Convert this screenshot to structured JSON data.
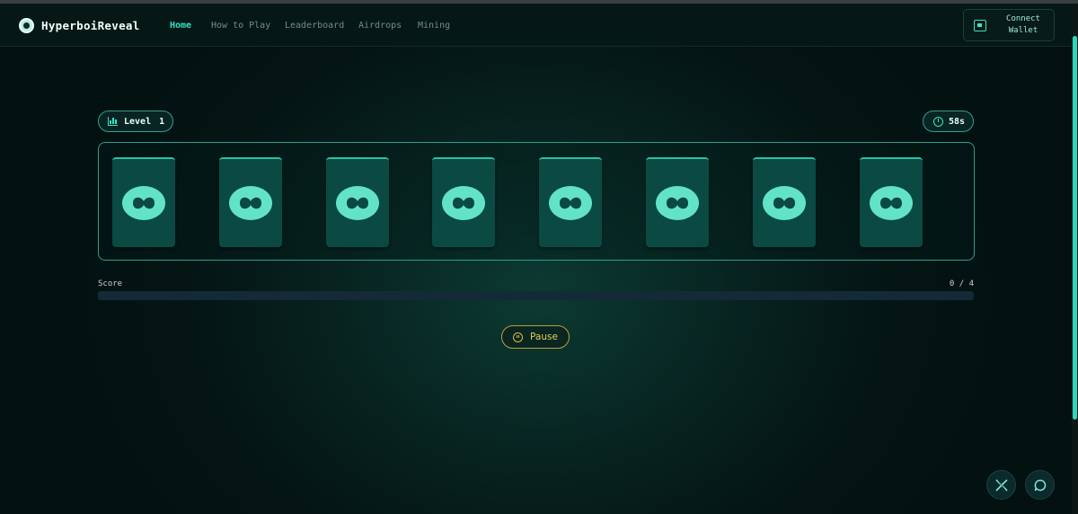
{
  "brand": {
    "name": "HyperboiReveal",
    "logo_icon": "hyperboi-logo-icon"
  },
  "nav": {
    "items": [
      {
        "label": "Home",
        "active": true
      },
      {
        "label": "How to Play",
        "active": false
      },
      {
        "label": "Leaderboard",
        "active": false
      },
      {
        "label": "Airdrops",
        "active": false
      },
      {
        "label": "Mining",
        "active": false
      }
    ]
  },
  "wallet": {
    "line1": "Connect",
    "line2": "Wallet",
    "icon": "wallet-icon"
  },
  "game": {
    "level_label": "Level",
    "level": "1",
    "timer": "58s",
    "card_count": 8,
    "card_icon": "hyperboi-card-back-icon",
    "score_label": "Score",
    "score_text": "0 / 4",
    "progress": 0,
    "pause_label": "Pause"
  },
  "social": {
    "x_icon": "x-twitter-icon",
    "chat_icon": "chat-icon"
  },
  "colors": {
    "accent": "#2fd6bd",
    "pause_accent": "#d9bf4a",
    "card": "#0a4a43"
  }
}
